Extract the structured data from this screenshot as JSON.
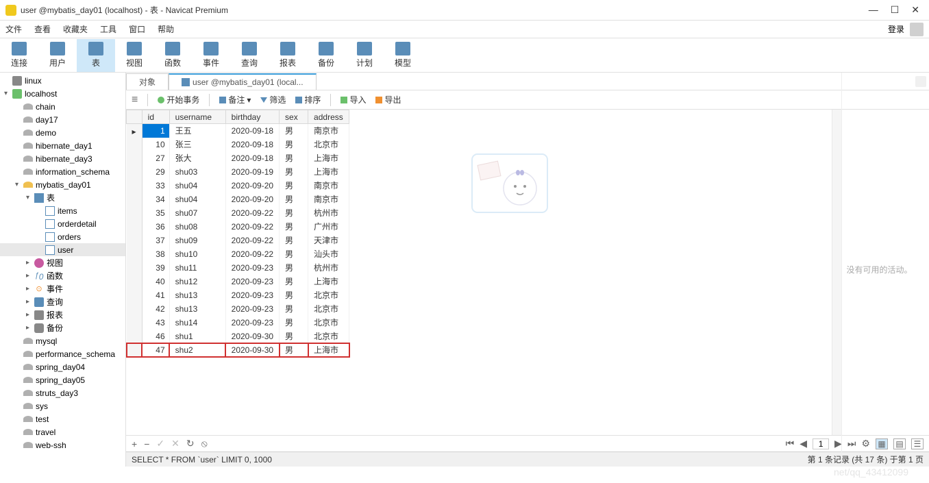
{
  "window": {
    "title": "user @mybatis_day01 (localhost) - 表 - Navicat Premium"
  },
  "menubar": {
    "items": [
      "文件",
      "查看",
      "收藏夹",
      "工具",
      "窗口",
      "帮助"
    ],
    "login": "登录"
  },
  "toolbar": {
    "items": [
      "连接",
      "用户",
      "表",
      "视图",
      "函数",
      "事件",
      "查询",
      "报表",
      "备份",
      "计划",
      "模型"
    ],
    "active_index": 2
  },
  "sidebar": {
    "tree": [
      {
        "level": 0,
        "type": "server",
        "label": "linux",
        "expand": ""
      },
      {
        "level": 0,
        "type": "conn",
        "label": "localhost",
        "expand": "▾"
      },
      {
        "level": 1,
        "type": "db",
        "label": "chain"
      },
      {
        "level": 1,
        "type": "db",
        "label": "day17"
      },
      {
        "level": 1,
        "type": "db",
        "label": "demo"
      },
      {
        "level": 1,
        "type": "db",
        "label": "hibernate_day1"
      },
      {
        "level": 1,
        "type": "db",
        "label": "hibernate_day3"
      },
      {
        "level": 1,
        "type": "db",
        "label": "information_schema"
      },
      {
        "level": 1,
        "type": "db",
        "label": "mybatis_day01",
        "expand": "▾",
        "active": true
      },
      {
        "level": 2,
        "type": "tables",
        "label": "表",
        "expand": "▾"
      },
      {
        "level": 3,
        "type": "table",
        "label": "items"
      },
      {
        "level": 3,
        "type": "table",
        "label": "orderdetail"
      },
      {
        "level": 3,
        "type": "table",
        "label": "orders"
      },
      {
        "level": 3,
        "type": "table",
        "label": "user",
        "selected": true
      },
      {
        "level": 2,
        "type": "view",
        "label": "视图",
        "expand": "▸"
      },
      {
        "level": 2,
        "type": "func",
        "label": "函数",
        "expand": "▸"
      },
      {
        "level": 2,
        "type": "event",
        "label": "事件",
        "expand": "▸"
      },
      {
        "level": 2,
        "type": "query",
        "label": "查询",
        "expand": "▸"
      },
      {
        "level": 2,
        "type": "report",
        "label": "报表",
        "expand": "▸"
      },
      {
        "level": 2,
        "type": "backup",
        "label": "备份",
        "expand": "▸"
      },
      {
        "level": 1,
        "type": "db",
        "label": "mysql"
      },
      {
        "level": 1,
        "type": "db",
        "label": "performance_schema"
      },
      {
        "level": 1,
        "type": "db",
        "label": "spring_day04"
      },
      {
        "level": 1,
        "type": "db",
        "label": "spring_day05"
      },
      {
        "level": 1,
        "type": "db",
        "label": "struts_day3"
      },
      {
        "level": 1,
        "type": "db",
        "label": "sys"
      },
      {
        "level": 1,
        "type": "db",
        "label": "test"
      },
      {
        "level": 1,
        "type": "db",
        "label": "travel"
      },
      {
        "level": 1,
        "type": "db",
        "label": "web-ssh"
      }
    ]
  },
  "tabs": {
    "items": [
      {
        "label": "对象",
        "active": false
      },
      {
        "label": "user @mybatis_day01 (local...",
        "active": true,
        "icon": true
      }
    ]
  },
  "actionbar": {
    "begin_tx": "开始事务",
    "memo": "备注",
    "filter": "筛选",
    "sort": "排序",
    "import": "导入",
    "export": "导出"
  },
  "grid": {
    "columns": [
      "id",
      "username",
      "birthday",
      "sex",
      "address"
    ],
    "rows": [
      {
        "id": 1,
        "username": "王五",
        "birthday": "2020-09-18",
        "sex": "男",
        "address": "南京市",
        "current": true
      },
      {
        "id": 10,
        "username": "张三",
        "birthday": "2020-09-18",
        "sex": "男",
        "address": "北京市"
      },
      {
        "id": 27,
        "username": "张大",
        "birthday": "2020-09-18",
        "sex": "男",
        "address": "上海市"
      },
      {
        "id": 29,
        "username": "shu03",
        "birthday": "2020-09-19",
        "sex": "男",
        "address": "上海市"
      },
      {
        "id": 33,
        "username": "shu04",
        "birthday": "2020-09-20",
        "sex": "男",
        "address": "南京市"
      },
      {
        "id": 34,
        "username": "shu04",
        "birthday": "2020-09-20",
        "sex": "男",
        "address": "南京市"
      },
      {
        "id": 35,
        "username": "shu07",
        "birthday": "2020-09-22",
        "sex": "男",
        "address": "杭州市"
      },
      {
        "id": 36,
        "username": "shu08",
        "birthday": "2020-09-22",
        "sex": "男",
        "address": "广州市"
      },
      {
        "id": 37,
        "username": "shu09",
        "birthday": "2020-09-22",
        "sex": "男",
        "address": "天津市"
      },
      {
        "id": 38,
        "username": "shu10",
        "birthday": "2020-09-22",
        "sex": "男",
        "address": "汕头市"
      },
      {
        "id": 39,
        "username": "shu11",
        "birthday": "2020-09-23",
        "sex": "男",
        "address": "杭州市"
      },
      {
        "id": 40,
        "username": "shu12",
        "birthday": "2020-09-23",
        "sex": "男",
        "address": "上海市"
      },
      {
        "id": 41,
        "username": "shu13",
        "birthday": "2020-09-23",
        "sex": "男",
        "address": "北京市"
      },
      {
        "id": 42,
        "username": "shu13",
        "birthday": "2020-09-23",
        "sex": "男",
        "address": "北京市"
      },
      {
        "id": 43,
        "username": "shu14",
        "birthday": "2020-09-23",
        "sex": "男",
        "address": "北京市"
      },
      {
        "id": 46,
        "username": "shu1",
        "birthday": "2020-09-30",
        "sex": "男",
        "address": "北京市"
      },
      {
        "id": 47,
        "username": "shu2",
        "birthday": "2020-09-30",
        "sex": "男",
        "address": "上海市",
        "highlighted": true
      }
    ]
  },
  "footer": {
    "page_value": "1"
  },
  "statusbar": {
    "query": "SELECT * FROM `user` LIMIT 0, 1000",
    "record_info": "第 1 条记录 (共 17 条) 于第 1 页"
  },
  "right_panel": {
    "no_activity": "没有可用的活动。"
  },
  "watermark": "net/qq_43412099"
}
